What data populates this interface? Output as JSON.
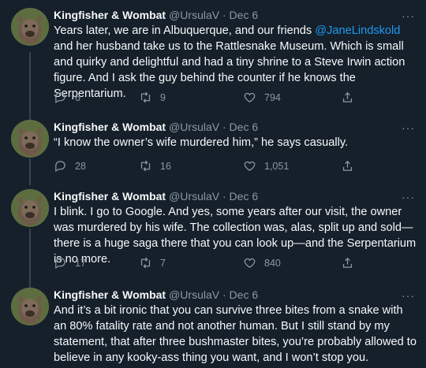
{
  "author": {
    "name": "Kingfisher & Wombat",
    "handle": "@UrsulaV",
    "separator": "·",
    "date": "Dec 6",
    "more": "···"
  },
  "tweets": [
    {
      "text_before": "Years later, we are in Albuquerque, and our friends ",
      "mention": "@JaneLindskold",
      "text_after": " and her husband take us to the Rattlesnake Museum. Which is small and quirky and delightful and had a tiny shrine to a Steve Irwin action figure. And I ask the guy behind the counter if he knows the Serpentarium.",
      "replies": "6",
      "retweets": "9",
      "likes": "794"
    },
    {
      "text": "“I know the owner’s wife murdered him,” he says casually.",
      "replies": "28",
      "retweets": "16",
      "likes": "1,051"
    },
    {
      "text": "I blink. I go to Google. And yes, some years after our visit, the owner was murdered by his wife. The collection was, alas, split up and sold—there is a huge saga there that you can look up—and the Serpentarium is no more.",
      "replies": "17",
      "retweets": "7",
      "likes": "840"
    },
    {
      "text": "And it’s a bit ironic that you can survive three bites from a snake with an 80% fatality rate and not another human. But I still stand by my statement, that after three bushmaster bites, you’re probably allowed to believe in any kooky-ass thing you want, and I won’t stop you."
    }
  ],
  "icons": {
    "reply": "reply-icon",
    "retweet": "retweet-icon",
    "like": "heart-icon",
    "share": "share-icon",
    "avatar": "wombat-avatar"
  },
  "colors": {
    "background": "#15202b",
    "text": "#f7f9f9",
    "secondary": "#8b98a5",
    "link": "#1d9bf0",
    "thread_line": "#38444d"
  }
}
